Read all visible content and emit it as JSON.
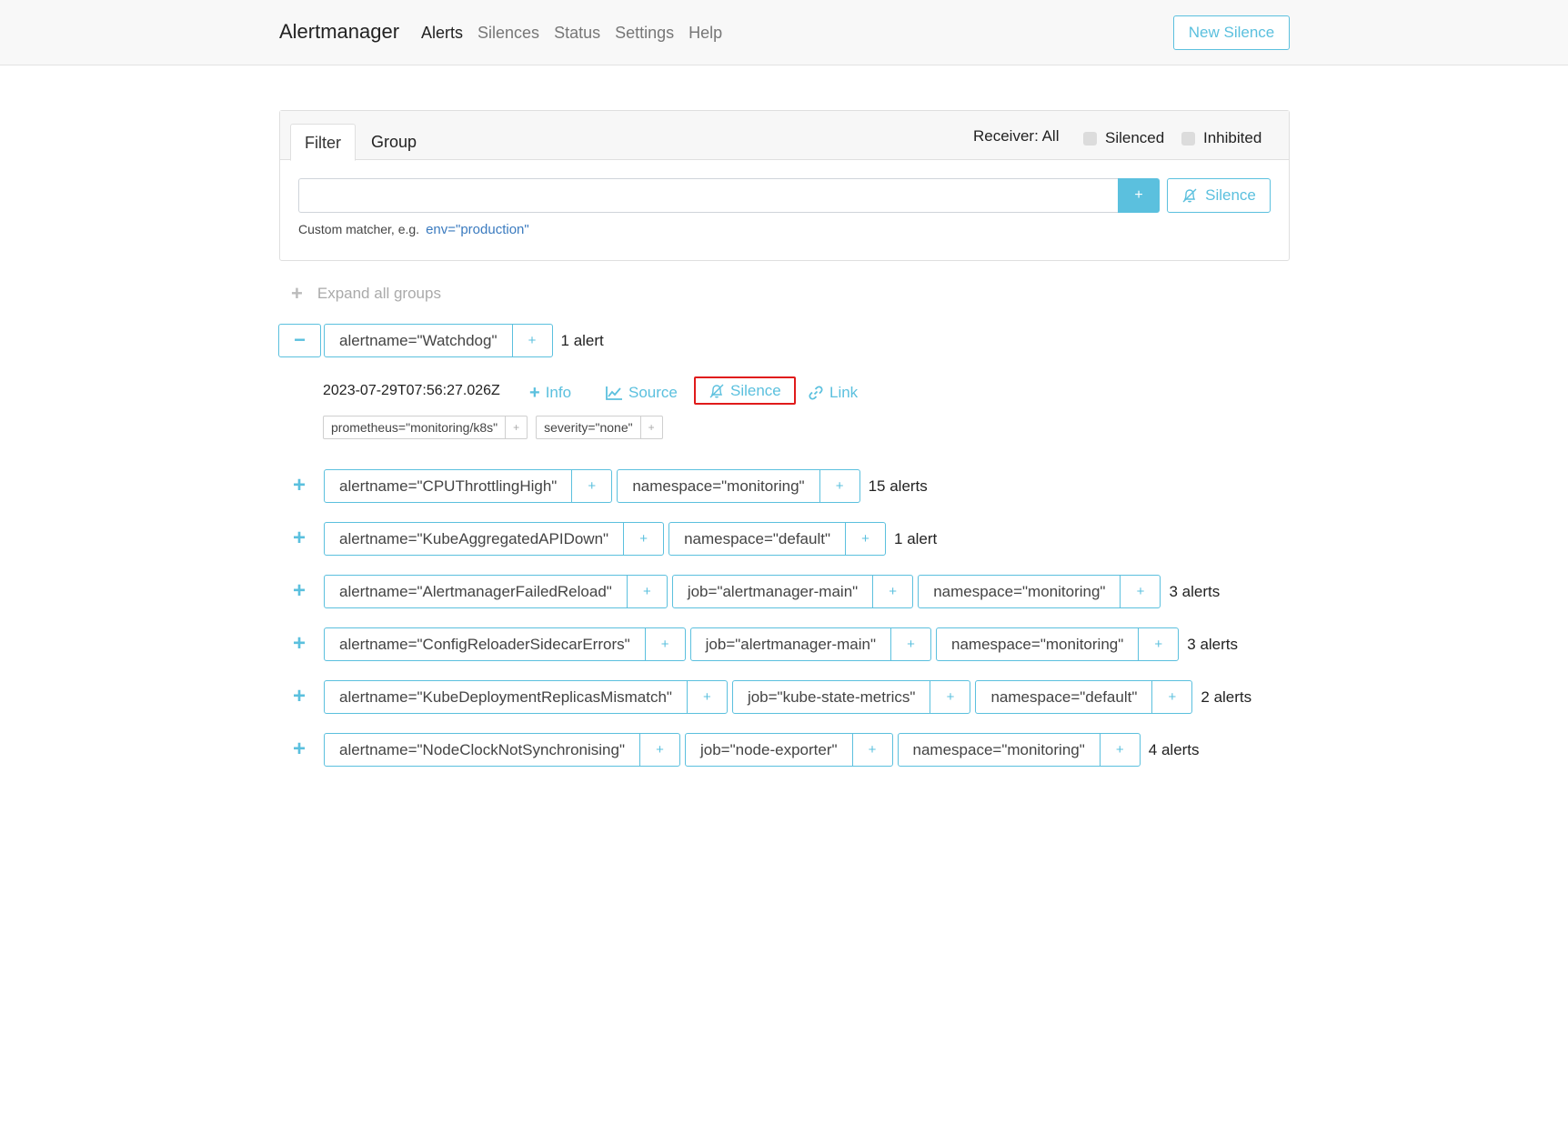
{
  "navbar": {
    "brand": "Alertmanager",
    "links": [
      "Alerts",
      "Silences",
      "Status",
      "Settings",
      "Help"
    ],
    "new_silence": "New Silence"
  },
  "filter_card": {
    "tabs": [
      "Filter",
      "Group"
    ],
    "receiver": "Receiver: All",
    "silenced": "Silenced",
    "inhibited": "Inhibited",
    "input_value": "",
    "add_button": "+",
    "silence_button": "Silence",
    "hint": "Custom matcher, e.g.",
    "hint_example": "env=\"production\""
  },
  "expand_all": "Expand all groups",
  "expanded_group": {
    "toggle": "−",
    "label": "alertname=\"Watchdog\"",
    "count": "1 alert",
    "alert": {
      "timestamp": "2023-07-29T07:56:27.026Z",
      "info": "Info",
      "source": "Source",
      "silence": "Silence",
      "link": "Link",
      "labels": [
        "prometheus=\"monitoring/k8s\"",
        "severity=\"none\""
      ]
    }
  },
  "groups": [
    {
      "labels": [
        "alertname=\"CPUThrottlingHigh\"",
        "namespace=\"monitoring\""
      ],
      "count": "15 alerts"
    },
    {
      "labels": [
        "alertname=\"KubeAggregatedAPIDown\"",
        "namespace=\"default\""
      ],
      "count": "1 alert"
    },
    {
      "labels": [
        "alertname=\"AlertmanagerFailedReload\"",
        "job=\"alertmanager-main\"",
        "namespace=\"monitoring\""
      ],
      "count": "3 alerts"
    },
    {
      "labels": [
        "alertname=\"ConfigReloaderSidecarErrors\"",
        "job=\"alertmanager-main\"",
        "namespace=\"monitoring\""
      ],
      "count": "3 alerts"
    },
    {
      "labels": [
        "alertname=\"KubeDeploymentReplicasMismatch\"",
        "job=\"kube-state-metrics\"",
        "namespace=\"default\""
      ],
      "count": "2 alerts"
    },
    {
      "labels": [
        "alertname=\"NodeClockNotSynchronising\"",
        "job=\"node-exporter\"",
        "namespace=\"monitoring\""
      ],
      "count": "4 alerts"
    }
  ],
  "icons": {
    "plus": "+",
    "accent_color": "#5bc0de",
    "highlight_color": "#e01b1b"
  }
}
